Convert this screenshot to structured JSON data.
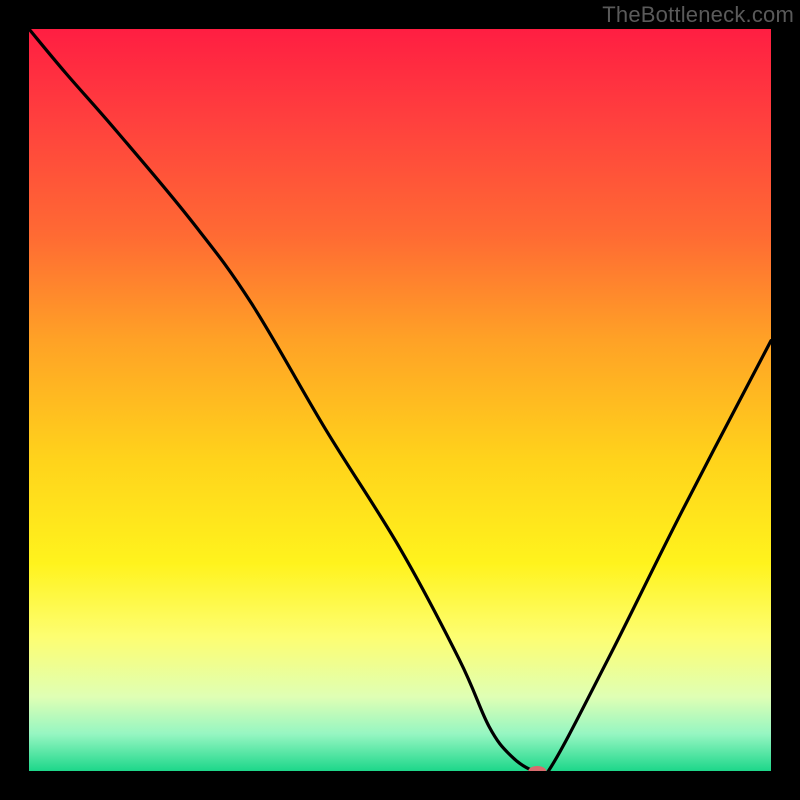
{
  "watermark": "TheBottleneck.com",
  "chart_data": {
    "type": "line",
    "title": "",
    "xlabel": "",
    "ylabel": "",
    "x_range": [
      0,
      100
    ],
    "y_range": [
      0,
      100
    ],
    "background_gradient": {
      "stops": [
        {
          "offset": 0.0,
          "color": "#ff1e42"
        },
        {
          "offset": 0.12,
          "color": "#ff3f3e"
        },
        {
          "offset": 0.28,
          "color": "#ff6b33"
        },
        {
          "offset": 0.42,
          "color": "#ffa226"
        },
        {
          "offset": 0.58,
          "color": "#ffd31b"
        },
        {
          "offset": 0.72,
          "color": "#fff31d"
        },
        {
          "offset": 0.82,
          "color": "#fdfe72"
        },
        {
          "offset": 0.9,
          "color": "#dfffb4"
        },
        {
          "offset": 0.95,
          "color": "#96f6c2"
        },
        {
          "offset": 1.0,
          "color": "#1dd78a"
        }
      ]
    },
    "series": [
      {
        "name": "curve",
        "x": [
          0,
          5,
          12,
          22,
          30,
          40,
          50,
          58,
          62,
          65,
          68,
          70,
          78,
          88,
          100
        ],
        "y": [
          100,
          94,
          86,
          74,
          63,
          46,
          30,
          15,
          6,
          2,
          0,
          0,
          15,
          35,
          58
        ]
      }
    ],
    "marker": {
      "name": "optimum-marker",
      "x": 68.5,
      "y": 0,
      "color": "#d86b6e",
      "rx": 9,
      "ry": 5
    }
  }
}
